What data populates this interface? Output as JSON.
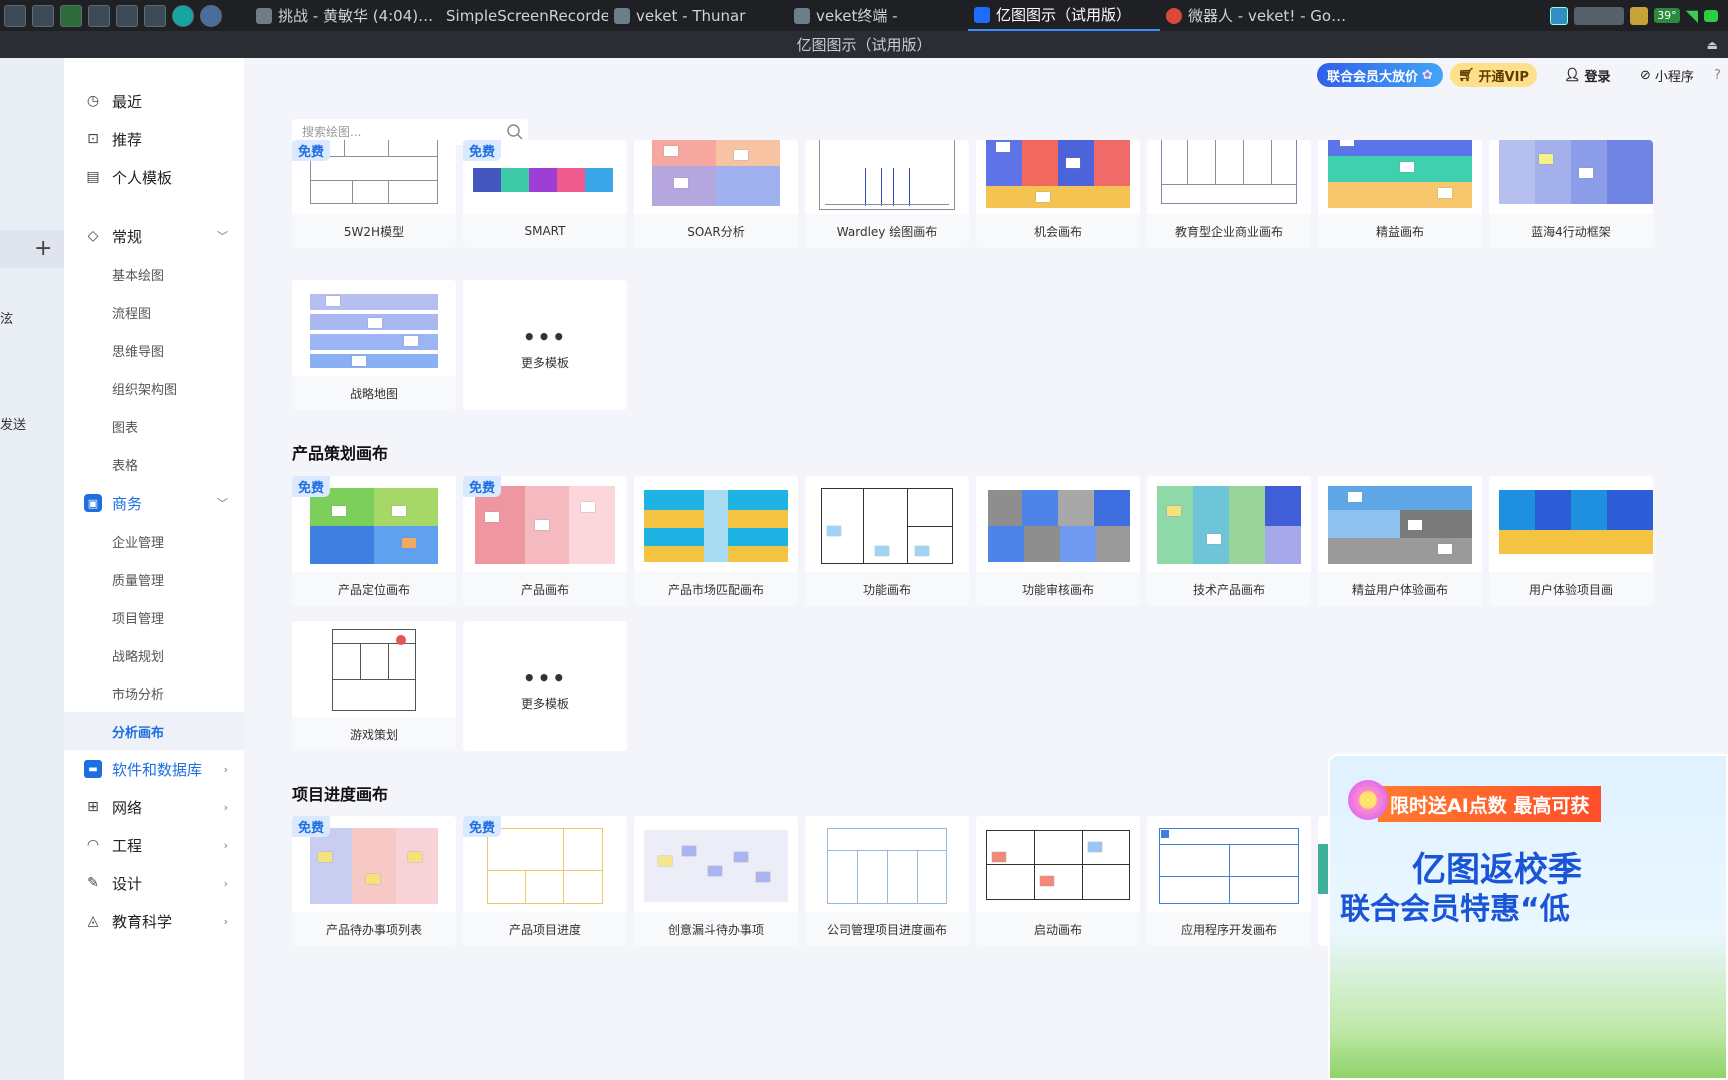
{
  "taskbar": {
    "tasks": [
      {
        "label": "挑战 - 黄敏华 (4:04)…"
      },
      {
        "label": "SimpleScreenRecorder"
      },
      {
        "label": "veket - Thunar"
      },
      {
        "label": "veket终端 -"
      },
      {
        "label": "亿图图示（试用版）"
      },
      {
        "label": "微器人 - veket! - Go…"
      }
    ],
    "tray_temp": "39°"
  },
  "window": {
    "title": "亿图图示（试用版）"
  },
  "left_strip": {
    "fragment_a": "泫",
    "fragment_b": "发送"
  },
  "sidebar": {
    "recent": "最近",
    "recommend": "推荐",
    "personal": "个人模板",
    "general": "常规",
    "general_items": [
      "基本绘图",
      "流程图",
      "思维导图",
      "组织架构图",
      "图表",
      "表格"
    ],
    "business": "商务",
    "business_items": [
      "企业管理",
      "质量管理",
      "项目管理",
      "战略规划",
      "市场分析",
      "分析画布"
    ],
    "software": "软件和数据库",
    "network": "网络",
    "engineering": "工程",
    "design": "设计",
    "education": "教育科学"
  },
  "top": {
    "promo": "联合会员大放价",
    "vip": "开通VIP",
    "login": "登录",
    "mini": "小程序"
  },
  "search": {
    "placeholder": "搜索绘图..."
  },
  "free_badge": "免费",
  "more_label": "更多模板",
  "more_dots": "•••",
  "row1": [
    "5W2H模型",
    "SMART",
    "SOAR分析",
    "Wardley 绘图画布",
    "机会画布",
    "教育型企业商业画布",
    "精益画布",
    "蓝海4行动框架"
  ],
  "row2": [
    "战略地图"
  ],
  "section2": {
    "title": "产品策划画布",
    "row1": [
      "产品定位画布",
      "产品画布",
      "产品市场匹配画布",
      "功能画布",
      "功能审核画布",
      "技术产品画布",
      "精益用户体验画布",
      "用户体验项目画"
    ],
    "row2": [
      "游戏策划"
    ]
  },
  "section3": {
    "title": "项目进度画布",
    "row1": [
      "产品待办事项列表",
      "产品项目进度",
      "创意漏斗待办事项",
      "公司管理项目进度画布",
      "启动画布",
      "应用程序开发画布"
    ]
  },
  "popup": {
    "ribbon": "限时送AI点数 最高可获",
    "line1": "亿图返校季",
    "line2": "联合会员特惠“低"
  }
}
